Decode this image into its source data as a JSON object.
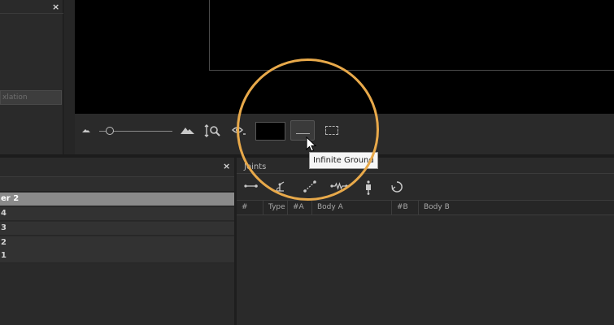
{
  "top_left_panel": {
    "close_label": "×",
    "field_text": "xlation"
  },
  "viewport_toolbar": {
    "icons": [
      "zoom-out-mountain-icon",
      "zoom-slider",
      "zoom-in-mountain-icon",
      "fit-zoom-icon",
      "visibility-eye-icon",
      "background-color-swatch",
      "infinite-ground-icon",
      "marquee-select-icon"
    ],
    "background_color": "#000000"
  },
  "tooltip": {
    "text": "Infinite Ground"
  },
  "layers_panel": {
    "close_label": "×",
    "rows": [
      {
        "label": "er 2",
        "selected": true
      },
      {
        "label": "4",
        "selected": false
      },
      {
        "label": "3",
        "selected": false
      },
      {
        "label": "2",
        "selected": false
      },
      {
        "label": "1",
        "selected": false
      }
    ]
  },
  "joints_panel": {
    "title": "Joints",
    "toolbar_icons": [
      "pin-joint-icon",
      "angle-joint-icon",
      "distance-joint-icon",
      "spring-joint-icon",
      "piston-joint-icon",
      "rotary-joint-icon"
    ],
    "columns": [
      "#",
      "Type",
      "#A",
      "Body A",
      "#B",
      "Body B"
    ]
  },
  "colors": {
    "highlight": "#e8a94a",
    "selected_row": "#8a8a8a",
    "panel_bg": "#2a2a2a"
  }
}
